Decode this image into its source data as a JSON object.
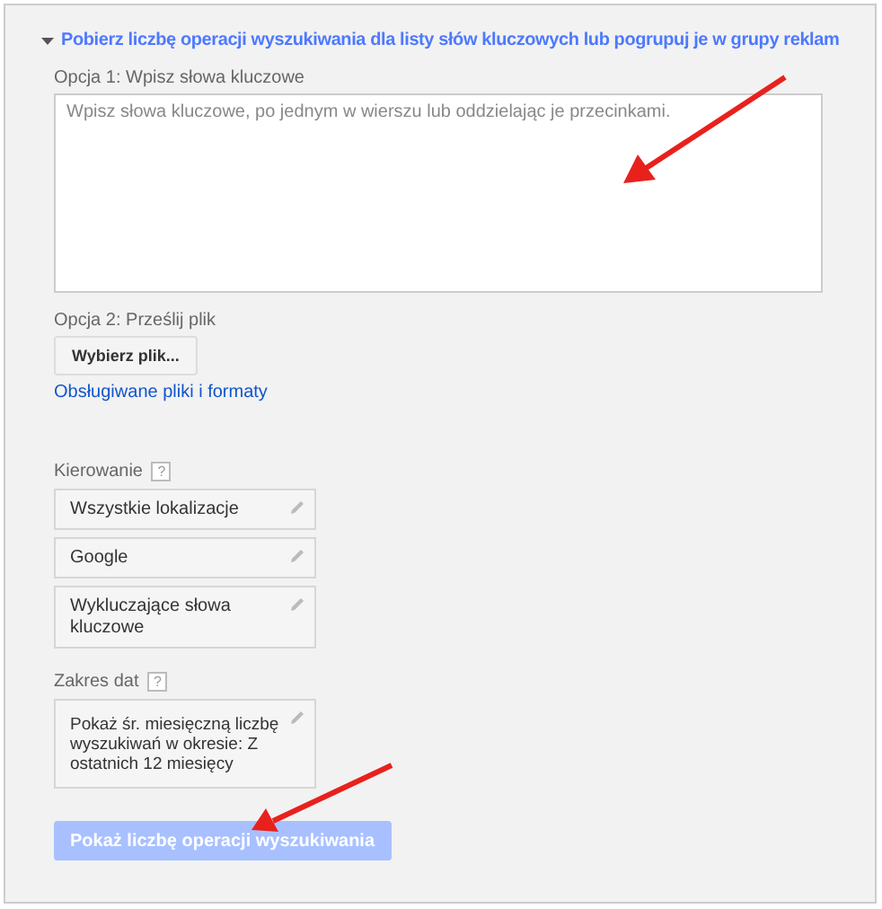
{
  "section": {
    "title": "Pobierz liczbę operacji wyszukiwania dla listy słów kluczowych lub pogrupuj je w grupy reklam",
    "expanded": true
  },
  "option1": {
    "label": "Opcja 1: Wpisz słowa kluczowe",
    "placeholder": "Wpisz słowa kluczowe, po jednym w wierszu lub oddzielając je przecinkami."
  },
  "option2": {
    "label": "Opcja 2: Prześlij plik",
    "button": "Wybierz plik...",
    "link": "Obsługiwane pliki i formaty"
  },
  "targeting": {
    "label": "Kierowanie",
    "help": "?",
    "items": [
      "Wszystkie lokalizacje",
      "Google",
      "Wykluczające słowa kluczowe"
    ]
  },
  "date_range": {
    "label": "Zakres dat",
    "help": "?",
    "value": "Pokaż śr. miesięczną liczbę wyszukiwań w okresie: Z ostatnich 12 miesięcy"
  },
  "submit": {
    "label": "Pokaż liczbę operacji wyszukiwania",
    "disabled": true
  }
}
